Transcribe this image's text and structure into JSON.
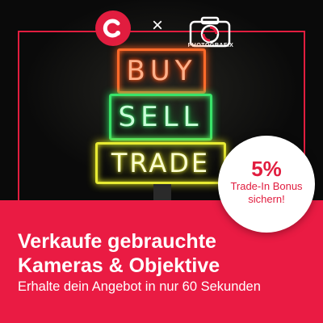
{
  "logos": {
    "brand_icon": "c-logo-icon",
    "separator": "×",
    "partner_icon": "camera-icon",
    "partner_name": "PHOTOGRAFIX"
  },
  "signs": {
    "buy": "BUY",
    "sell": "SELL",
    "trade": "TRADE"
  },
  "badge": {
    "percent": "5%",
    "line1": "Trade-In Bonus",
    "line2": "sichern!"
  },
  "headline": {
    "line1": "Verkaufe gebrauchte",
    "line2": "Kameras & Objektive"
  },
  "subline": "Erhalte dein Angebot in nur 60 Sekunden",
  "colors": {
    "brand_red": "#ea1b43",
    "frame_red": "#e11d3f",
    "neon_orange": "#ff6a2a",
    "neon_green": "#39e36a",
    "neon_yellow": "#e7ea33"
  }
}
